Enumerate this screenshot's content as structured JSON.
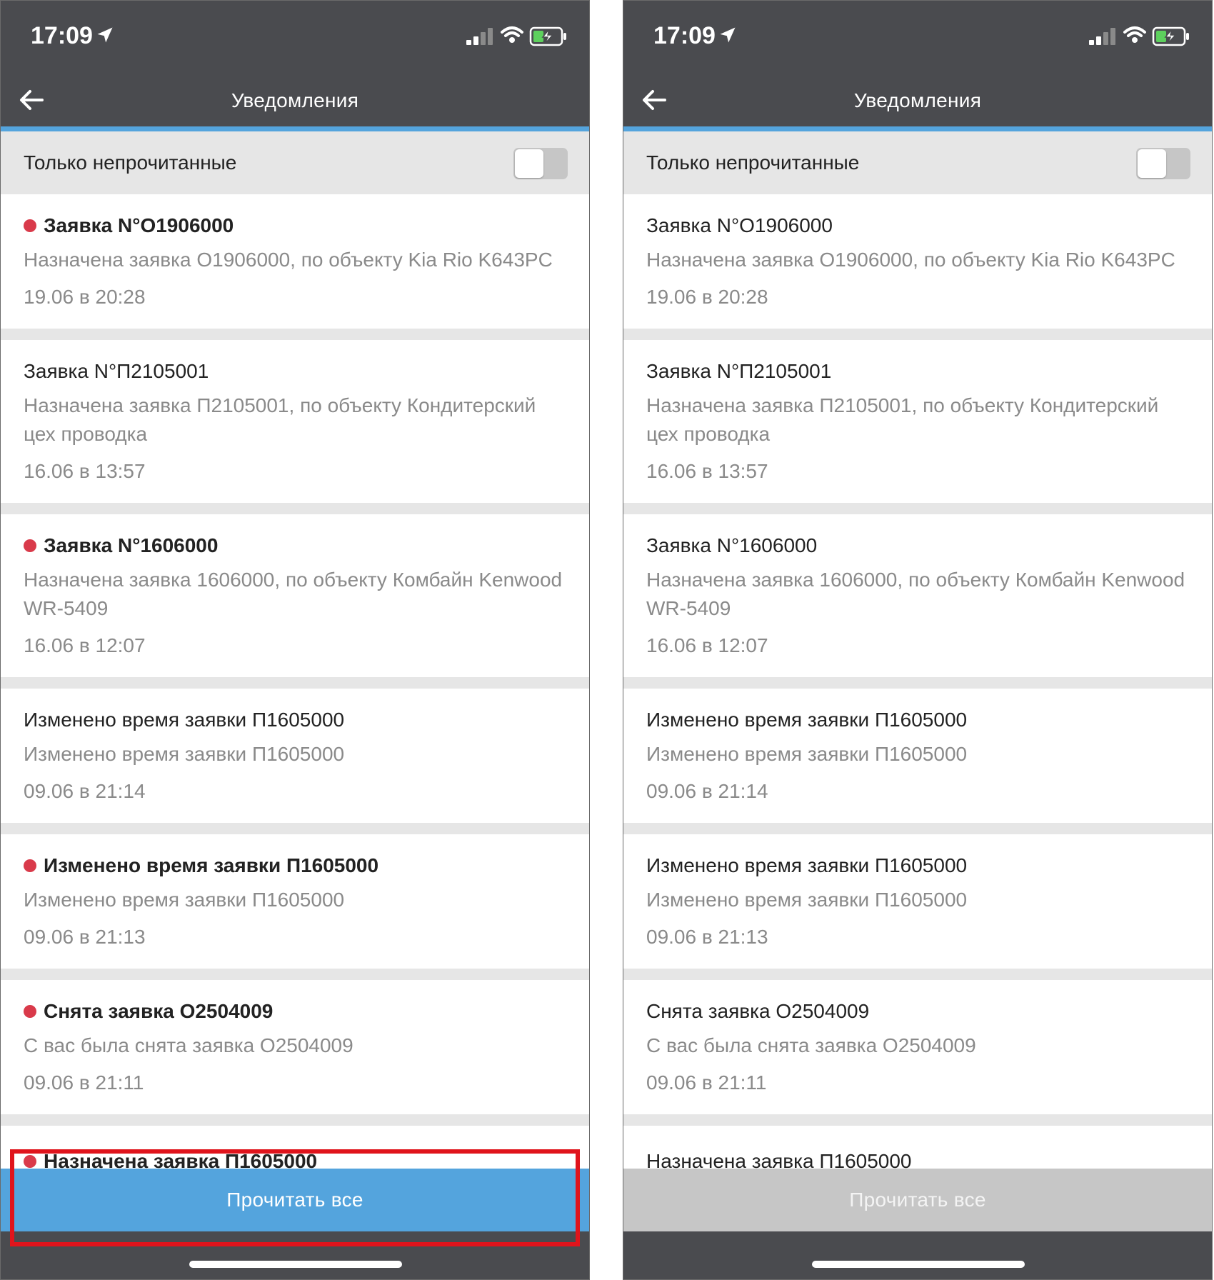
{
  "status_bar": {
    "time": "17:09"
  },
  "header": {
    "title": "Уведомления"
  },
  "filter": {
    "label": "Только непрочитанные",
    "enabled": false
  },
  "notifications_left": [
    {
      "title": "Заявка N°O1906000",
      "body": "Назначена заявка  O1906000, по объекту Kia Rio K643PC",
      "date": "19.06 в 20:28"
    },
    {
      "title": "Заявка N°П2105001",
      "body": "Назначена заявка  П2105001, по объекту Кондитерский цех проводка",
      "date": "16.06 в 13:57"
    },
    {
      "title": "Заявка N°1606000",
      "body": "Назначена заявка  1606000, по объекту Комбайн Kenwood WR-5409",
      "date": "16.06 в 12:07"
    },
    {
      "title": "Изменено время заявки П1605000",
      "body": "Изменено время заявки П1605000",
      "date": "09.06 в 21:14"
    },
    {
      "title": "Изменено время заявки П1605000",
      "body": "Изменено время заявки П1605000",
      "date": "09.06 в 21:13"
    },
    {
      "title": "Снята заявка O2504009",
      "body": "С вас была снята заявка O2504009",
      "date": "09.06 в 21:11"
    },
    {
      "title": "Назначена заявка П1605000"
    }
  ],
  "notifications_right": [
    {
      "title": "Заявка N°O1906000",
      "body": "Назначена заявка  O1906000, по объекту Kia Rio K643PC",
      "date": "19.06 в 20:28"
    },
    {
      "title": "Заявка N°П2105001",
      "body": "Назначена заявка  П2105001, по объекту Кондитерский цех проводка",
      "date": "16.06 в 13:57"
    },
    {
      "title": "Заявка N°1606000",
      "body": "Назначена заявка  1606000, по объекту Комбайн Kenwood WR-5409",
      "date": "16.06 в 12:07"
    },
    {
      "title": "Изменено время заявки П1605000",
      "body": "Изменено время заявки П1605000",
      "date": "09.06 в 21:14"
    },
    {
      "title": "Изменено время заявки П1605000",
      "body": "Изменено время заявки П1605000",
      "date": "09.06 в 21:13"
    },
    {
      "title": "Снята заявка O2504009",
      "body": "С вас была снята заявка O2504009",
      "date": "09.06 в 21:11"
    },
    {
      "title": "Назначена заявка П1605000"
    }
  ],
  "unread_left": [
    true,
    false,
    true,
    false,
    true,
    true,
    true
  ],
  "unread_right": [
    false,
    false,
    false,
    false,
    false,
    false,
    false
  ],
  "read_all_button": {
    "label": "Прочитать все"
  },
  "colors": {
    "header_bg": "#4a4b4f",
    "accent_blue": "#54a4dd",
    "unread_dot": "#d93a4a",
    "disabled_button": "#c6c6c6",
    "highlight_red": "#e0141c"
  }
}
